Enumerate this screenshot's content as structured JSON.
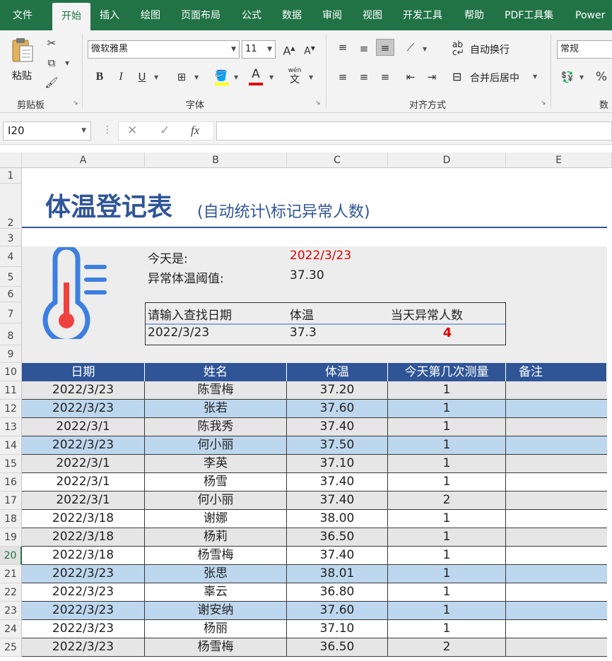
{
  "ribbon_tabs": [
    "文件",
    "开始",
    "插入",
    "绘图",
    "页面布局",
    "公式",
    "数据",
    "审阅",
    "视图",
    "开发工具",
    "帮助",
    "PDF工具集",
    "Power"
  ],
  "clipboard": {
    "paste": "粘贴",
    "label": "剪贴板"
  },
  "font": {
    "name": "微软雅黑",
    "size": "11",
    "bold": "B",
    "italic": "I",
    "underline": "U",
    "grow": "A",
    "shrink": "A",
    "color_glyph": "A",
    "phonetic": "wén",
    "phonetic_sub": "文",
    "label": "字体"
  },
  "alignment": {
    "wrap_text": "自动换行",
    "merge_center": "合并后居中",
    "label": "对齐方式"
  },
  "number": {
    "format": "常规",
    "label": "数",
    "percent": "%"
  },
  "formula_bar": {
    "name_box": "I20",
    "fx": "fx",
    "value": ""
  },
  "columns": [
    "A",
    "B",
    "C",
    "D",
    "E"
  ],
  "rows": [
    "1",
    "2",
    "3",
    "4",
    "5",
    "6",
    "7",
    "8",
    "9",
    "10",
    "11",
    "12",
    "13",
    "14",
    "15",
    "16",
    "17",
    "18",
    "19",
    "20",
    "21",
    "22",
    "23",
    "24",
    "25"
  ],
  "sheet": {
    "title": "体温登记表",
    "subtitle": "(自动统计\\标记异常人数)",
    "today_label": "今天是:",
    "today_value": "2022/3/23",
    "threshold_label": "异常体温阈值:",
    "threshold_value": "37.30",
    "lookup": {
      "headers": [
        "请输入查找日期",
        "体温",
        "当天异常人数"
      ],
      "values": [
        "2022/3/23",
        "37.3",
        "4"
      ]
    },
    "table_headers": [
      "日期",
      "姓名",
      "体温",
      "今天第几次测量",
      "备注"
    ],
    "table_rows": [
      [
        "2022/3/23",
        "陈雪梅",
        "37.20",
        "1",
        ""
      ],
      [
        "2022/3/23",
        "张若",
        "37.60",
        "1",
        ""
      ],
      [
        "2022/3/1",
        "陈我秀",
        "37.40",
        "1",
        ""
      ],
      [
        "2022/3/23",
        "何小丽",
        "37.50",
        "1",
        ""
      ],
      [
        "2022/3/1",
        "李英",
        "37.10",
        "1",
        ""
      ],
      [
        "2022/3/1",
        "杨雪",
        "37.40",
        "1",
        ""
      ],
      [
        "2022/3/1",
        "何小丽",
        "37.40",
        "2",
        ""
      ],
      [
        "2022/3/18",
        "谢娜",
        "38.00",
        "1",
        ""
      ],
      [
        "2022/3/18",
        "杨莉",
        "36.50",
        "1",
        ""
      ],
      [
        "2022/3/18",
        "杨雪梅",
        "37.40",
        "1",
        ""
      ],
      [
        "2022/3/23",
        "张思",
        "38.01",
        "1",
        ""
      ],
      [
        "2022/3/23",
        "辜云",
        "36.80",
        "1",
        ""
      ],
      [
        "2022/3/23",
        "谢安纳",
        "37.60",
        "1",
        ""
      ],
      [
        "2022/3/23",
        "杨丽",
        "37.10",
        "1",
        ""
      ],
      [
        "2022/3/23",
        "杨雪梅",
        "36.50",
        "2",
        ""
      ]
    ],
    "row_fills": [
      "gray",
      "blue",
      "gray",
      "blue",
      "gray",
      "white",
      "gray",
      "white",
      "gray",
      "white",
      "blue",
      "white",
      "blue",
      "white",
      "gray"
    ]
  },
  "colors": {
    "excel_green": "#217346",
    "title_blue": "#2f5597",
    "highlight_blue": "#bdd7ee",
    "alert_red": "#e00000"
  }
}
